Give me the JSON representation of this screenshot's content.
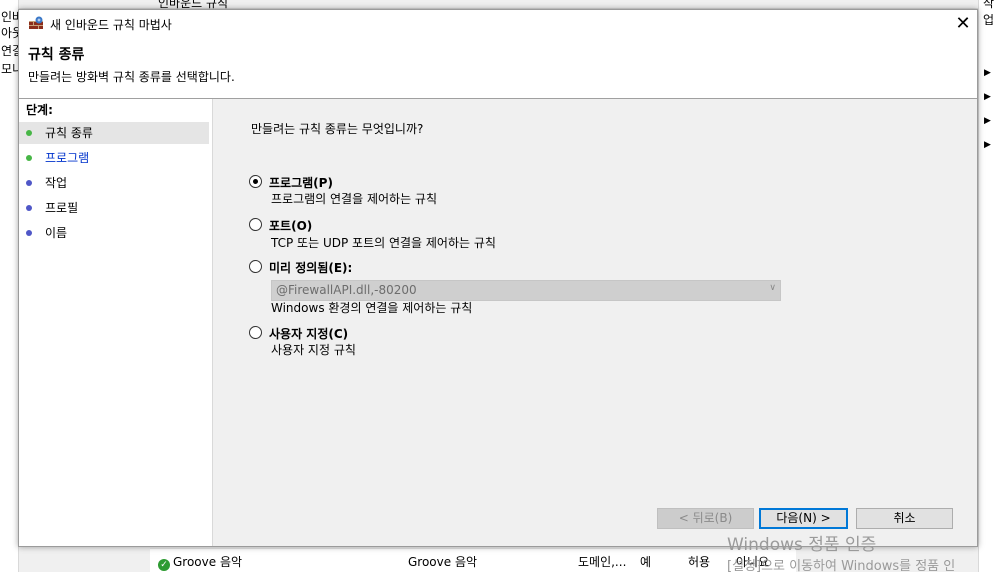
{
  "background": {
    "left_fragments": [
      "인바",
      "아웃",
      "연결",
      "모니"
    ],
    "right_fragment": "작업",
    "top_fragments": [
      "인바운드 규칙"
    ],
    "row": {
      "name": "Groove 음악",
      "group": "Groove 음악",
      "profile": "도메인,...",
      "enabled": "예",
      "action": "허용",
      "override": "아니요"
    },
    "watermark": {
      "line1": "Windows 정품 인증",
      "line2": "[설정]으로 이동하여 Windows를 정품 인"
    }
  },
  "dialog": {
    "title": "새 인바운드 규칙 마법사",
    "close": "✕",
    "header_title": "규칙 종류",
    "header_desc": "만들려는 방화벽 규칙 종류를 선택합니다.",
    "steps_title": "단계:",
    "steps": [
      {
        "label": "규칙 종류",
        "dot": "green",
        "current": true,
        "link": false
      },
      {
        "label": "프로그램",
        "dot": "green",
        "current": false,
        "link": true
      },
      {
        "label": "작업",
        "dot": "blue",
        "current": false,
        "link": false
      },
      {
        "label": "프로필",
        "dot": "blue",
        "current": false,
        "link": false
      },
      {
        "label": "이름",
        "dot": "blue",
        "current": false,
        "link": false
      }
    ],
    "question": "만들려는 규칙 종류는 무엇입니까?",
    "options": [
      {
        "label": "프로그램(P)",
        "desc": "프로그램의 연결을 제어하는 규칙",
        "checked": true
      },
      {
        "label": "포트(O)",
        "desc": "TCP 또는 UDP 포트의 연결을 제어하는 규칙",
        "checked": false
      },
      {
        "label": "미리 정의됨(E):",
        "select_value": "@FirewallAPI.dll,-80200",
        "desc": "Windows 환경의 연결을 제어하는 규칙",
        "checked": false
      },
      {
        "label": "사용자 지정(C)",
        "desc": "사용자 지정 규칙",
        "checked": false
      }
    ],
    "buttons": {
      "back": "< 뒤로(B)",
      "next": "다음(N) >",
      "cancel": "취소"
    }
  },
  "colors": {
    "step_green": "#47b646",
    "step_blue": "#4f57c7",
    "link": "#0033cc",
    "focus": "#0078d7"
  }
}
